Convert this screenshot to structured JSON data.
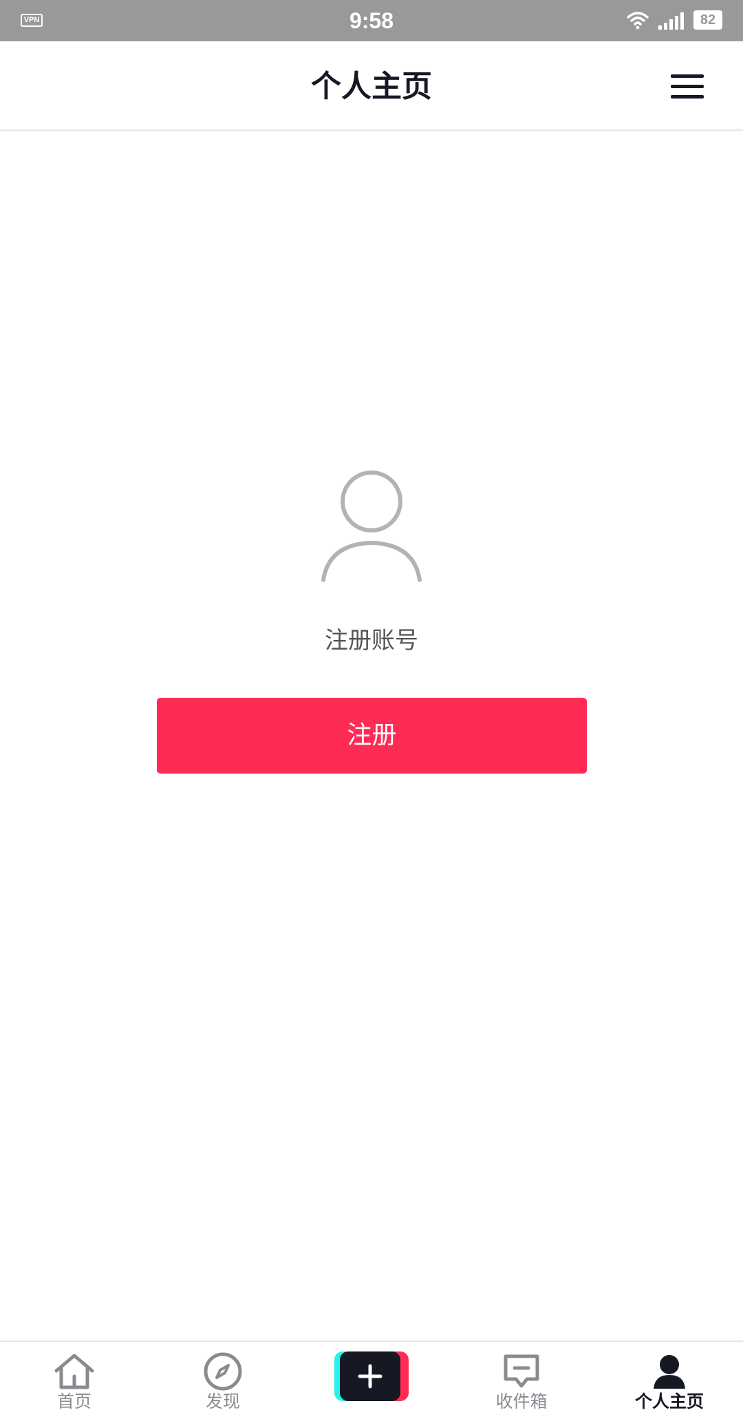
{
  "status_bar": {
    "vpn_label": "VPN",
    "time": "9:58",
    "battery": "82",
    "icons": [
      "wifi-icon",
      "signal-icon"
    ]
  },
  "header": {
    "title": "个人主页",
    "menu_icon": "hamburger-menu-icon"
  },
  "main": {
    "avatar_icon": "user-placeholder-icon",
    "hint": "注册账号",
    "register_label": "注册"
  },
  "bottom_nav": {
    "items": [
      {
        "label": "首页",
        "icon": "home-icon",
        "active": false
      },
      {
        "label": "发现",
        "icon": "compass-icon",
        "active": false
      },
      {
        "label": "",
        "icon": "create-plus-icon",
        "active": false
      },
      {
        "label": "收件箱",
        "icon": "inbox-message-icon",
        "active": false
      },
      {
        "label": "个人主页",
        "icon": "profile-icon",
        "active": true
      }
    ]
  },
  "colors": {
    "accent": "#fe2c55",
    "accent_cyan": "#25f4ee",
    "dark": "#161823",
    "inactive": "#8a8b91",
    "status_bar_bg": "#999999"
  }
}
